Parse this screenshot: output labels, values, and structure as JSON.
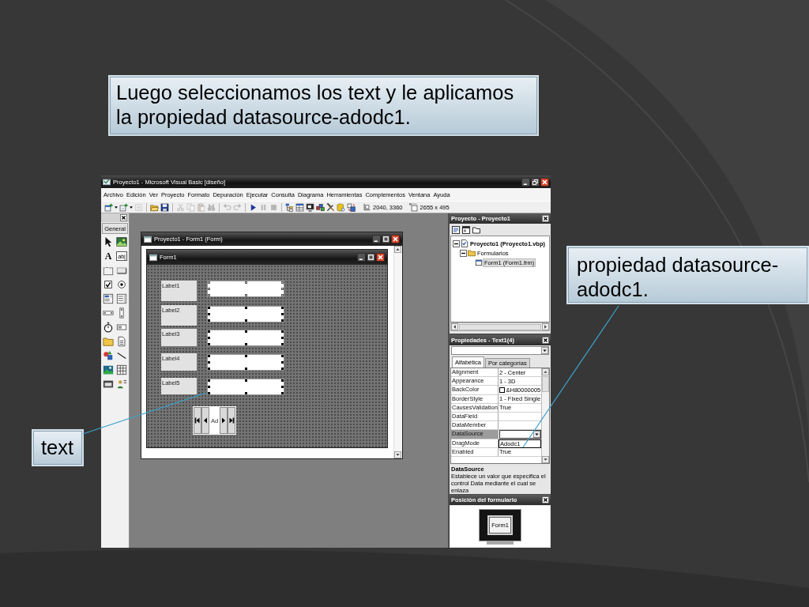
{
  "title_callout": {
    "text": "Luego seleccionamos los text y le aplicamos la propiedad datasource-adodc1."
  },
  "datasource_callout": {
    "text": "propiedad datasource-adodc1."
  },
  "text_callout": {
    "text": "text"
  },
  "ide": {
    "title": "Proyecto1 - Microsoft Visual Basic [diseño]",
    "menu": [
      "Archivo",
      "Edición",
      "Ver",
      "Proyecto",
      "Formato",
      "Depuración",
      "Ejecutar",
      "Consulta",
      "Diagrama",
      "Herramientas",
      "Complementos",
      "Ventana",
      "Ayuda"
    ],
    "toolbar_groups": [
      [
        {
          "kind": "project",
          "dropdown": true,
          "disabled": false
        },
        {
          "kind": "form",
          "dropdown": true,
          "disabled": false
        },
        {
          "kind": "menu",
          "dropdown": false,
          "disabled": true
        }
      ],
      [
        {
          "kind": "open",
          "dropdown": false,
          "disabled": false
        },
        {
          "kind": "save",
          "dropdown": false,
          "disabled": false
        }
      ],
      [
        {
          "kind": "cut",
          "dropdown": false,
          "disabled": true
        },
        {
          "kind": "copy",
          "dropdown": false,
          "disabled": true
        },
        {
          "kind": "paste",
          "dropdown": false,
          "disabled": true
        },
        {
          "kind": "find",
          "dropdown": false,
          "disabled": true
        }
      ],
      [
        {
          "kind": "undo",
          "dropdown": false,
          "disabled": true
        },
        {
          "kind": "redo",
          "dropdown": false,
          "disabled": true
        }
      ],
      [
        {
          "kind": "run",
          "dropdown": false,
          "disabled": false
        },
        {
          "kind": "pause",
          "dropdown": false,
          "disabled": true
        },
        {
          "kind": "stop",
          "dropdown": false,
          "disabled": true
        }
      ],
      [
        {
          "kind": "explorer",
          "dropdown": false,
          "disabled": false
        },
        {
          "kind": "properties",
          "dropdown": false,
          "disabled": false
        },
        {
          "kind": "layout",
          "dropdown": false,
          "disabled": false
        },
        {
          "kind": "browser",
          "dropdown": false,
          "disabled": false
        },
        {
          "kind": "toolbox",
          "dropdown": false,
          "disabled": false
        },
        {
          "kind": "dataview",
          "dropdown": false,
          "disabled": false
        },
        {
          "kind": "components",
          "dropdown": false,
          "disabled": false
        }
      ]
    ],
    "readouts": [
      {
        "kind": "position",
        "text": "2040, 3360"
      },
      {
        "kind": "size",
        "text": "2655 x 495"
      }
    ],
    "toolbox": {
      "tab": "General",
      "tools": [
        {
          "kind": "pointer"
        },
        {
          "kind": "picture"
        },
        {
          "kind": "label",
          "glyph": "A"
        },
        {
          "kind": "textbox",
          "glyph": "ab|"
        },
        {
          "kind": "frame"
        },
        {
          "kind": "command"
        },
        {
          "kind": "checkbox"
        },
        {
          "kind": "option"
        },
        {
          "kind": "combo"
        },
        {
          "kind": "list"
        },
        {
          "kind": "hscroll"
        },
        {
          "kind": "vscroll"
        },
        {
          "kind": "timer"
        },
        {
          "kind": "drive"
        },
        {
          "kind": "dir"
        },
        {
          "kind": "file"
        },
        {
          "kind": "shape"
        },
        {
          "kind": "line"
        },
        {
          "kind": "image"
        },
        {
          "kind": "data"
        },
        {
          "kind": "ole"
        },
        {
          "kind": "adodc"
        }
      ]
    },
    "designer": {
      "title": "Proyecto1 - Form1 (Form)",
      "form": {
        "title": "Form1",
        "labels": [
          "Label1",
          "Label2",
          "Label3",
          "Label4",
          "Label5"
        ],
        "text_boxes": [
          {
            "selected": true,
            "primary": true
          },
          {
            "selected": true,
            "primary": false
          },
          {
            "selected": true,
            "primary": false
          },
          {
            "selected": true,
            "primary": false
          },
          {
            "selected": true,
            "primary": false
          }
        ],
        "data_control": {
          "caption": "Ad"
        }
      }
    },
    "project": {
      "title": "Proyecto - Proyecto1",
      "tree": [
        {
          "label": "Proyecto1 (Proyecto1.vbp)",
          "kind": "project",
          "expanded": true,
          "selected": false,
          "children": [
            {
              "label": "Formularios",
              "kind": "folder",
              "expanded": true,
              "selected": false,
              "children": [
                {
                  "label": "Form1 (Form1.frm)",
                  "kind": "form",
                  "selected": true
                }
              ]
            }
          ]
        }
      ]
    },
    "properties": {
      "title": "Propiedades - Text1(4)",
      "tabs": [
        {
          "label": "Alfabética",
          "selected": true
        },
        {
          "label": "Por categorías",
          "selected": false
        }
      ],
      "rows": [
        {
          "name": "Alignment",
          "value": "2 - Center",
          "kind": "text",
          "selected": false
        },
        {
          "name": "Appearance",
          "value": "1 - 3D",
          "kind": "text",
          "selected": false
        },
        {
          "name": "BackColor",
          "value": "&H80000005",
          "kind": "color",
          "color": "#ffffff",
          "selected": false
        },
        {
          "name": "BorderStyle",
          "value": "1 - Fixed Single",
          "kind": "text",
          "selected": false
        },
        {
          "name": "CausesValidation",
          "value": "True",
          "kind": "text",
          "selected": false
        },
        {
          "name": "DataField",
          "kind": "text",
          "selected": false
        },
        {
          "name": "DataMember",
          "kind": "text",
          "selected": false
        },
        {
          "name": "DataSource",
          "kind": "dropdown",
          "selected": true
        },
        {
          "name": "DragMode",
          "kind": "text",
          "selected": false
        },
        {
          "name": "Enabled",
          "value": "True",
          "kind": "text",
          "selected": false
        }
      ],
      "dropdown_list": [
        "Adodc1"
      ],
      "description": {
        "title": "DataSource",
        "text": "Establece un valor que especifica el control Data mediante el cual se enlaza"
      }
    },
    "form_layout": {
      "title": "Posición del formulario",
      "form_caption": "Form1"
    }
  }
}
